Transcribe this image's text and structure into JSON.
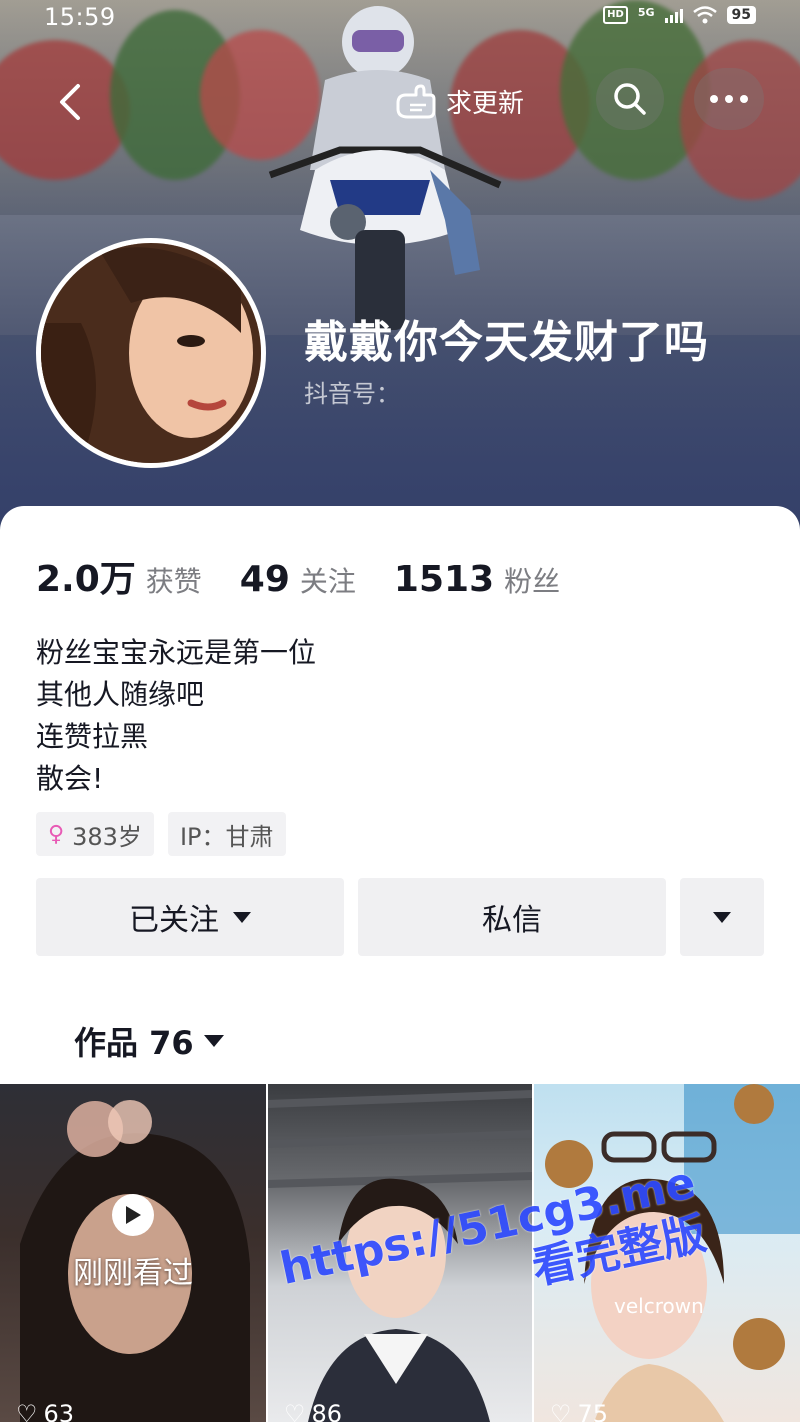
{
  "status_bar": {
    "time": "15:59",
    "hd": "HD",
    "network": "5G",
    "battery": "95"
  },
  "header": {
    "request_update": "求更新",
    "nickname": "戴戴你今天发财了吗",
    "douyin_id_label": "抖音号："
  },
  "stats": [
    {
      "value": "2.0万",
      "label": "获赞"
    },
    {
      "value": "49",
      "label": "关注"
    },
    {
      "value": "1513",
      "label": "粉丝"
    }
  ],
  "bio": [
    "粉丝宝宝永远是第一位",
    "其他人随缘吧",
    "连赞拉黑",
    "散会!"
  ],
  "tags": {
    "age": "383岁",
    "ip": "IP：甘肃"
  },
  "actions": {
    "followed": "已关注",
    "message": "私信"
  },
  "works_tab": {
    "label": "作品 76"
  },
  "videos": [
    {
      "likes": "63",
      "overlay": "刚刚看过"
    },
    {
      "likes": "86"
    },
    {
      "likes": "75",
      "caption": "velcrown"
    }
  ],
  "watermark": {
    "line1": "https://51cg3.me",
    "line2": "看完整版"
  },
  "colors": {
    "cover_bottom": "#34406a",
    "stat_label": "#7c7d82",
    "button_bg": "#f0f0f2",
    "watermark": "#2f4bff"
  }
}
